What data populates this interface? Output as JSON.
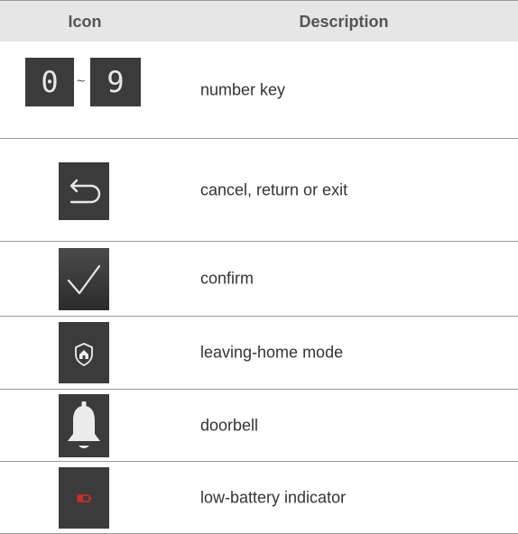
{
  "header": {
    "icon_col": "Icon",
    "desc_col": "Description"
  },
  "rows": [
    {
      "icon": "number-key-icons",
      "digit_start": "0",
      "separator": "~",
      "digit_end": "9",
      "description": "number key"
    },
    {
      "icon": "return-arrow-icon",
      "description": "cancel, return or exit"
    },
    {
      "icon": "checkmark-icon",
      "description": "confirm"
    },
    {
      "icon": "home-shield-icon",
      "description": "leaving-home mode"
    },
    {
      "icon": "bell-icon",
      "description": "doorbell"
    },
    {
      "icon": "battery-low-icon",
      "description": "low-battery indicator"
    }
  ],
  "colors": {
    "tile": "#3b3b3b",
    "header_bg": "#e6e6e6",
    "battery_red": "#d62a2a",
    "rule": "#9a9a9a"
  }
}
